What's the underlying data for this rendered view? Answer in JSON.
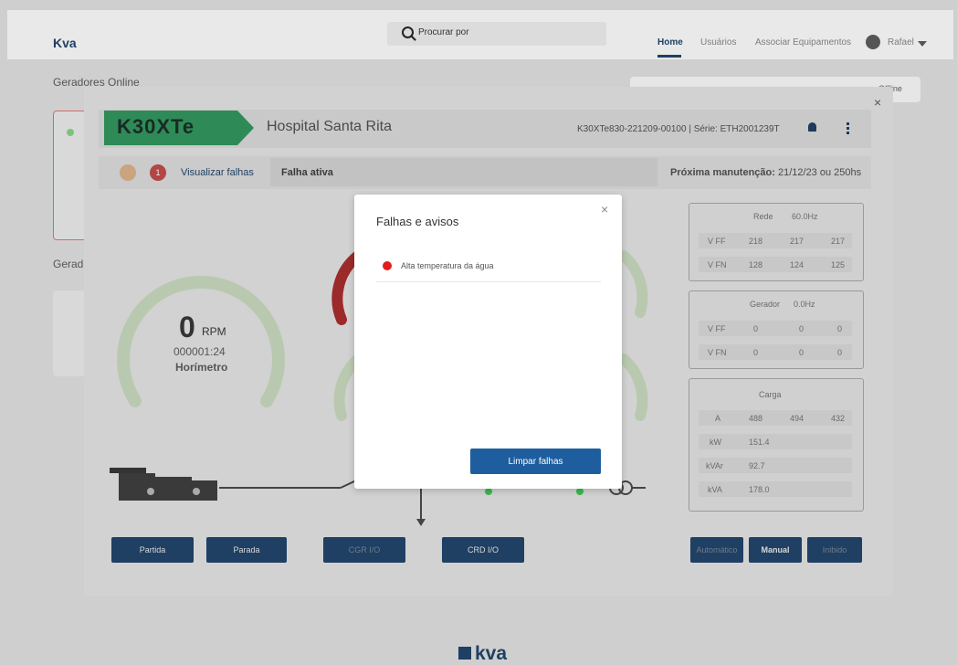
{
  "navbar": {
    "brand": "Kva",
    "search_placeholder": "Procurar por",
    "links": [
      "Home",
      "Usuários",
      "Associar Equipamentos"
    ],
    "user_name": "Rafael"
  },
  "background_page": {
    "title_online": "Geradores Online",
    "title_other": "Gerad",
    "legend_partial": "Offline"
  },
  "device": {
    "model_logo": "K30XTe",
    "name": "Hospital Santa Rita",
    "serial": "K30XTe830-221209-00100 | Série: ETH2001239T",
    "fault_count": "1",
    "view_faults": "Visualizar falhas",
    "active_fault": "Falha ativa",
    "maintenance_label": "Próxima manutenção:",
    "maintenance_value": "21/12/23 ou 250hs",
    "rpm_value": "0",
    "rpm_unit": "RPM",
    "hours": "000001:24",
    "hours_label": "Horímetro"
  },
  "tables": {
    "rede": {
      "title": "Rede",
      "freq": "60.0Hz",
      "rows": [
        {
          "label": "V FF",
          "v1": "218",
          "v2": "217",
          "v3": "217"
        },
        {
          "label": "V FN",
          "v1": "128",
          "v2": "124",
          "v3": "125"
        }
      ]
    },
    "gerador": {
      "title": "Gerador",
      "freq": "0.0Hz",
      "rows": [
        {
          "label": "V FF",
          "v1": "0",
          "v2": "0",
          "v3": "0"
        },
        {
          "label": "V FN",
          "v1": "0",
          "v2": "0",
          "v3": "0"
        }
      ]
    },
    "carga": {
      "title": "Carga",
      "rows": [
        {
          "label": "A",
          "v1": "488",
          "v2": "494",
          "v3": "432"
        },
        {
          "label": "kW",
          "v1": "151.4",
          "v2": "",
          "v3": ""
        },
        {
          "label": "kVAr",
          "v1": "92.7",
          "v2": "",
          "v3": ""
        },
        {
          "label": "kVA",
          "v1": "178.0",
          "v2": "",
          "v3": ""
        }
      ]
    }
  },
  "buttons": {
    "partida": "Partida",
    "parada": "Parada",
    "cgr_io": "CGR I/O",
    "crd_io": "CRD I/O",
    "automatico": "Automático",
    "manual": "Manual",
    "inibido": "Inibido"
  },
  "dialog": {
    "title": "Falhas e avisos",
    "alarm": "Alta temperatura da água",
    "clear_button": "Limpar falhas"
  },
  "footer": {
    "logo": "kva"
  },
  "colors": {
    "brand_blue": "#1f3f63",
    "alarm_red": "#e21b1b",
    "logo_green": "#2e8b57"
  }
}
